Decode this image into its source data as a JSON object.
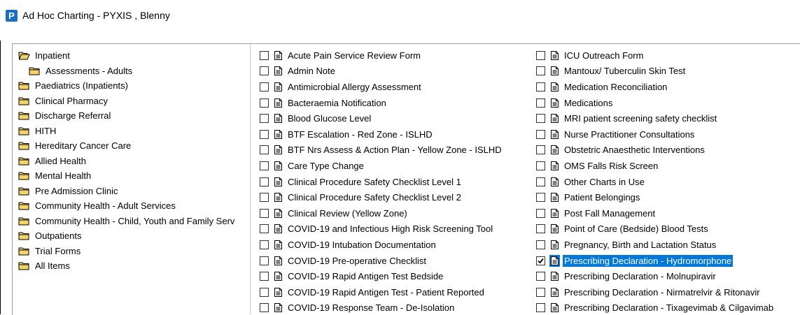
{
  "window": {
    "app_icon_letter": "P",
    "title": "Ad Hoc Charting - PYXIS , Blenny"
  },
  "tree": [
    {
      "label": "Inpatient",
      "open": true,
      "level": 0
    },
    {
      "label": "Assessments - Adults",
      "open": false,
      "level": 1
    },
    {
      "label": "Paediatrics (Inpatients)",
      "open": false,
      "level": 0
    },
    {
      "label": "Clinical Pharmacy",
      "open": false,
      "level": 0
    },
    {
      "label": "Discharge Referral",
      "open": false,
      "level": 0
    },
    {
      "label": "HITH",
      "open": false,
      "level": 0
    },
    {
      "label": "Hereditary Cancer Care",
      "open": false,
      "level": 0
    },
    {
      "label": "Allied Health",
      "open": false,
      "level": 0
    },
    {
      "label": "Mental Health",
      "open": false,
      "level": 0
    },
    {
      "label": "Pre Admission Clinic",
      "open": false,
      "level": 0
    },
    {
      "label": "Community Health - Adult Services",
      "open": false,
      "level": 0
    },
    {
      "label": "Community Health - Child, Youth and Family Serv",
      "open": false,
      "level": 0
    },
    {
      "label": "Outpatients",
      "open": false,
      "level": 0
    },
    {
      "label": " Trial Forms",
      "open": false,
      "level": 0
    },
    {
      "label": "All Items",
      "open": false,
      "level": 0
    }
  ],
  "forms": {
    "column1": [
      {
        "label": "Acute Pain Service Review Form",
        "checked": false,
        "selected": false
      },
      {
        "label": "Admin Note",
        "checked": false,
        "selected": false
      },
      {
        "label": "Antimicrobial Allergy Assessment",
        "checked": false,
        "selected": false
      },
      {
        "label": "Bacteraemia Notification",
        "checked": false,
        "selected": false
      },
      {
        "label": "Blood Glucose Level",
        "checked": false,
        "selected": false
      },
      {
        "label": "BTF Escalation - Red Zone - ISLHD",
        "checked": false,
        "selected": false
      },
      {
        "label": "BTF Nrs Assess & Action Plan - Yellow Zone - ISLHD",
        "checked": false,
        "selected": false
      },
      {
        "label": "Care Type Change",
        "checked": false,
        "selected": false
      },
      {
        "label": "Clinical Procedure Safety Checklist Level 1",
        "checked": false,
        "selected": false
      },
      {
        "label": "Clinical Procedure Safety Checklist Level 2",
        "checked": false,
        "selected": false
      },
      {
        "label": "Clinical Review (Yellow Zone)",
        "checked": false,
        "selected": false
      },
      {
        "label": "COVID-19 and Infectious High Risk Screening Tool",
        "checked": false,
        "selected": false
      },
      {
        "label": "COVID-19 Intubation Documentation",
        "checked": false,
        "selected": false
      },
      {
        "label": "COVID-19 Pre-operative Checklist",
        "checked": false,
        "selected": false
      },
      {
        "label": "COVID-19 Rapid Antigen Test Bedside",
        "checked": false,
        "selected": false
      },
      {
        "label": "COVID-19 Rapid Antigen Test - Patient Reported",
        "checked": false,
        "selected": false
      },
      {
        "label": "COVID-19 Response Team - De-Isolation",
        "checked": false,
        "selected": false
      }
    ],
    "column2": [
      {
        "label": "ICU Outreach Form",
        "checked": false,
        "selected": false
      },
      {
        "label": "Mantoux/ Tuberculin Skin Test",
        "checked": false,
        "selected": false
      },
      {
        "label": "Medication Reconciliation",
        "checked": false,
        "selected": false
      },
      {
        "label": "Medications",
        "checked": false,
        "selected": false
      },
      {
        "label": "MRI patient screening safety checklist",
        "checked": false,
        "selected": false
      },
      {
        "label": "Nurse Practitioner Consultations",
        "checked": false,
        "selected": false
      },
      {
        "label": "Obstetric Anaesthetic Interventions",
        "checked": false,
        "selected": false
      },
      {
        "label": "OMS Falls Risk Screen",
        "checked": false,
        "selected": false
      },
      {
        "label": "Other Charts in Use",
        "checked": false,
        "selected": false
      },
      {
        "label": "Patient Belongings",
        "checked": false,
        "selected": false
      },
      {
        "label": "Post Fall Management",
        "checked": false,
        "selected": false
      },
      {
        "label": "Point of Care (Bedside) Blood Tests",
        "checked": false,
        "selected": false
      },
      {
        "label": "Pregnancy, Birth and Lactation Status",
        "checked": false,
        "selected": false
      },
      {
        "label": "Prescribing Declaration - Hydromorphone",
        "checked": true,
        "selected": true
      },
      {
        "label": "Prescribing Declaration - Molnupiravir",
        "checked": false,
        "selected": false
      },
      {
        "label": "Prescribing Declaration - Nirmatrelvir & Ritonavir",
        "checked": false,
        "selected": false
      },
      {
        "label": "Prescribing Declaration - Tixagevimab & Cilgavimab",
        "checked": false,
        "selected": false
      }
    ]
  },
  "colors": {
    "folder_fill": "#f3d46b",
    "folder_stroke": "#000000",
    "selection": "#0078d7",
    "app_icon": "#1a6fc4"
  },
  "icons": {
    "tree_closed": "folder-icon",
    "tree_open": "folder-open-icon",
    "form": "document-icon",
    "check": "checkmark-icon"
  }
}
